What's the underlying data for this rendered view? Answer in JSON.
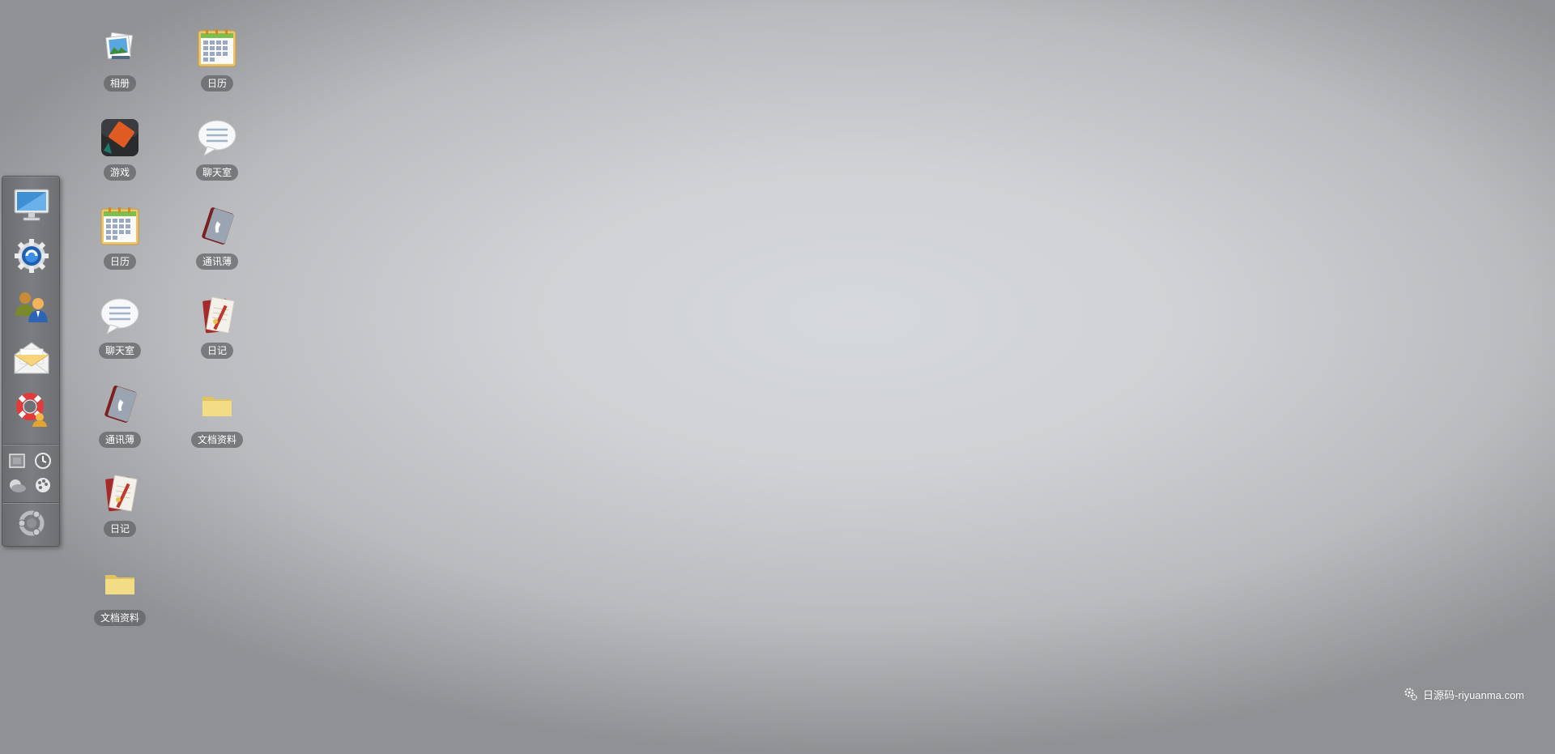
{
  "desktop": {
    "icons": [
      {
        "label": "相册",
        "icon": "photo-album-icon"
      },
      {
        "label": "日历",
        "icon": "calendar-icon"
      },
      {
        "label": "游戏",
        "icon": "game-icon"
      },
      {
        "label": "聊天室",
        "icon": "chat-bubble-icon"
      },
      {
        "label": "日历",
        "icon": "calendar-icon"
      },
      {
        "label": "通讯薄",
        "icon": "address-book-icon"
      },
      {
        "label": "聊天室",
        "icon": "chat-bubble-icon"
      },
      {
        "label": "日记",
        "icon": "diary-icon"
      },
      {
        "label": "通讯薄",
        "icon": "address-book-icon"
      },
      {
        "label": "文档资料",
        "icon": "folder-icon"
      },
      {
        "label": "日记",
        "icon": "diary-icon"
      },
      {
        "label": "文档资料",
        "icon": "folder-icon"
      }
    ]
  },
  "dock": {
    "apps": [
      {
        "icon": "monitor-icon"
      },
      {
        "icon": "settings-gear-icon"
      },
      {
        "icon": "users-icon"
      },
      {
        "icon": "mail-envelope-icon"
      },
      {
        "icon": "help-lifebuoy-icon"
      }
    ],
    "tools": [
      {
        "icon": "fullscreen-icon"
      },
      {
        "icon": "clock-icon"
      },
      {
        "icon": "weather-icon"
      },
      {
        "icon": "theme-palette-icon"
      }
    ],
    "start": {
      "icon": "start-menu-icon"
    }
  },
  "watermark": {
    "text": "日源码-riyuanma.com",
    "icon": "gear-cluster-icon"
  }
}
